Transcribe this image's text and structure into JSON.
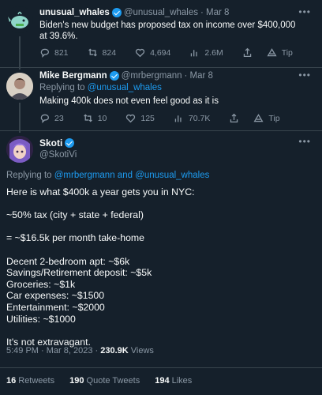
{
  "tweet1": {
    "name": "unusual_whales",
    "handle": "@unusual_whales",
    "date": "· Mar 8",
    "text": "Biden's new budget has proposed tax on income over $400,000 at 39.6%.",
    "replies": "821",
    "retweets": "824",
    "likes": "4,694",
    "views": "2.6M",
    "tip": "Tip"
  },
  "tweet2": {
    "name": "Mike Bergmann",
    "handle": "@mrbergmann",
    "date": "· Mar 8",
    "replying_prefix": "Replying to ",
    "replying_handle": "@unusual_whales",
    "text": "Making 400k does not even feel good as it is",
    "replies": "23",
    "retweets": "10",
    "likes": "125",
    "views": "70.7K",
    "tip": "Tip"
  },
  "tweet3": {
    "name": "Skoti",
    "handle": "@SkotiVi",
    "replying_prefix": "Replying to ",
    "replying_handle1": "@mrbergmann",
    "replying_and": " and ",
    "replying_handle2": "@unusual_whales",
    "lines": [
      "Here is what $400k a year gets you in NYC:",
      "",
      "~50% tax (city + state + federal)",
      "",
      "= ~$16.5k per month take-home",
      "",
      "Decent 2-bedroom apt: ~$6k",
      "Savings/Retirement deposit: ~$5k",
      "Groceries: ~$1k",
      "Car expenses: ~$1500",
      "Entertainment: ~$2000",
      "Utilities: ~$1000",
      "",
      "It's not extravagant."
    ],
    "timestamp": "5:49 PM · Mar 8, 2023 · ",
    "views_count": "230.9K",
    "views_label": " Views",
    "retweets_count": "16",
    "retweets_label": "Retweets",
    "quotes_count": "190",
    "quotes_label": "Quote Tweets",
    "likes_count": "194",
    "likes_label": "Likes"
  },
  "colors": {
    "background": "#15202b",
    "text": "#f7f9f9",
    "muted": "#8b98a5",
    "accent": "#1d9bf0",
    "divider": "#38444d"
  },
  "icons": [
    "reply-icon",
    "retweet-icon",
    "like-icon",
    "views-icon",
    "share-icon",
    "tip-icon",
    "more-icon",
    "verified-icon"
  ]
}
